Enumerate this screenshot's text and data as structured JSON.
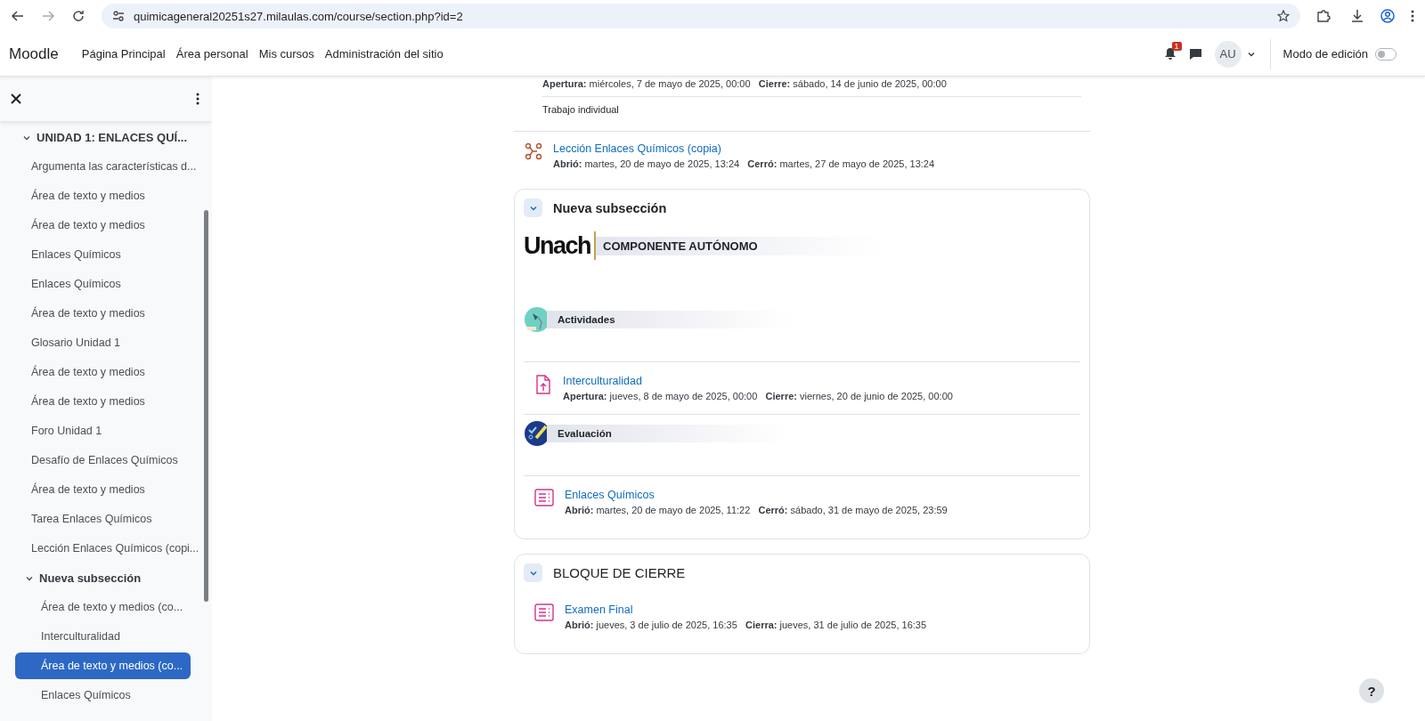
{
  "browser": {
    "url": "quimicageneral20251s27.milaulas.com/course/section.php?id=2"
  },
  "navbar": {
    "brand": "Moodle",
    "links": [
      "Página Principal",
      "Área personal",
      "Mis cursos",
      "Administración del sitio"
    ],
    "notification_count": "1",
    "avatar": "AU",
    "edit_mode": {
      "label": "Modo de edición",
      "on": false
    }
  },
  "drawer": {
    "tree": [
      {
        "label": "UNIDAD 1: ENLACES QUÍ...",
        "expanded": true,
        "children": [
          {
            "label": "Argumenta las características d...",
            "selected": false
          },
          {
            "label": "Área de texto y medios",
            "selected": false
          },
          {
            "label": "Área de texto y medios",
            "selected": false
          },
          {
            "label": "Enlaces Químicos",
            "selected": false
          },
          {
            "label": "Enlaces Químicos",
            "selected": false
          },
          {
            "label": "Área de texto y medios",
            "selected": false
          },
          {
            "label": "Glosario Unidad 1",
            "selected": false
          },
          {
            "label": "Área de texto y medios",
            "selected": false
          },
          {
            "label": "Área de texto y medios",
            "selected": false
          },
          {
            "label": "Foro Unidad 1",
            "selected": false
          },
          {
            "label": "Desafío de Enlaces Químicos",
            "selected": false
          },
          {
            "label": "Área de texto y medios",
            "selected": false
          },
          {
            "label": "Tarea Enlaces Químicos",
            "selected": false
          },
          {
            "label": "Lección Enlaces Químicos (copi...",
            "selected": false
          },
          {
            "label": "Nueva subsección",
            "expanded": true,
            "children": [
              {
                "label": "Área de texto y medios (co...",
                "selected": false
              },
              {
                "label": "Interculturalidad",
                "selected": false
              },
              {
                "label": "Área de texto y medios (co...",
                "selected": true
              },
              {
                "label": "Enlaces Químicos",
                "selected": false
              }
            ]
          }
        ]
      }
    ]
  },
  "main": {
    "top_activity": {
      "dates": [
        {
          "label": "Apertura:",
          "value": "miércoles, 7 de mayo de 2025, 00:00"
        },
        {
          "label": "Cierre:",
          "value": "sábado, 14 de junio de 2025, 00:00"
        }
      ],
      "note": "Trabajo individual"
    },
    "activities": [
      {
        "kind": "lesson",
        "title": "Lección Enlaces Químicos (copia)",
        "dates": [
          {
            "label": "Abrió:",
            "value": "martes, 20 de mayo de 2025, 13:24"
          },
          {
            "label": "Cerró:",
            "value": "martes, 27 de mayo de 2025, 13:24"
          }
        ]
      }
    ],
    "sections": [
      {
        "title": "Nueva subsección",
        "expanded": true,
        "caps": false,
        "items": [
          {
            "kind": "banner",
            "logo": "Unach",
            "title": "COMPONENTE AUTÓNOMO"
          },
          {
            "kind": "heading",
            "title": "Actividades"
          },
          {
            "kind": "assign",
            "title": "Interculturalidad",
            "dates": [
              {
                "label": "Apertura:",
                "value": "jueves, 8 de mayo de 2025, 00:00"
              },
              {
                "label": "Cierre:",
                "value": "viernes, 20 de junio de 2025, 00:00"
              }
            ]
          },
          {
            "kind": "heading",
            "title": "Evaluación"
          },
          {
            "kind": "quiz",
            "title": "Enlaces Químicos",
            "dates": [
              {
                "label": "Abrió:",
                "value": "martes, 20 de mayo de 2025, 11:22"
              },
              {
                "label": "Cerró:",
                "value": "sábado, 31 de mayo de 2025, 23:59"
              }
            ]
          }
        ]
      },
      {
        "title": "BLOQUE DE CIERRE",
        "expanded": true,
        "caps": true,
        "items": [
          {
            "kind": "quiz",
            "title": "Examen Final",
            "dates": [
              {
                "label": "Abrió:",
                "value": "jueves, 3 de julio de 2025, 16:35"
              },
              {
                "label": "Cierra:",
                "value": "jueves, 31 de julio de 2025, 16:35"
              }
            ]
          }
        ]
      }
    ]
  },
  "help": "?"
}
